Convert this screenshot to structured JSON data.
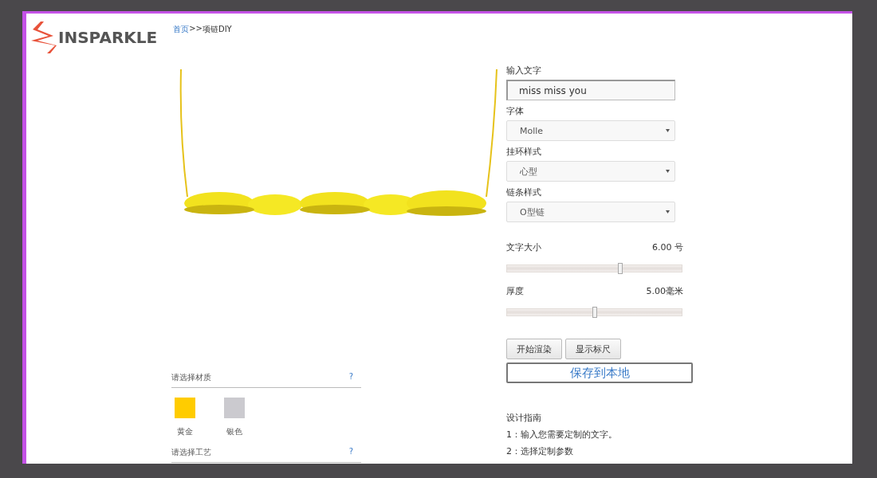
{
  "header": {
    "logo_text": "INSPARKLE",
    "breadcrumb": {
      "home": "首页",
      "separator": ">>",
      "current": "项链DIY"
    }
  },
  "sections": [
    {
      "title": "请选择材质",
      "help": "?",
      "materials": [
        {
          "label": "黄金",
          "color": "#ffcc00"
        },
        {
          "label": "银色",
          "color": "#cbcacf"
        }
      ]
    },
    {
      "title": "请选择工艺",
      "help": "?"
    }
  ],
  "form": {
    "text_label": "输入文字",
    "text_value": "miss miss you",
    "selects": [
      {
        "label": "字体",
        "value": "Molle"
      },
      {
        "label": "挂环样式",
        "value": "心型"
      },
      {
        "label": "链条样式",
        "value": "O型链"
      }
    ],
    "sliders": [
      {
        "label": "文字大小",
        "reading": "6.00 号",
        "level": 0.65
      },
      {
        "label": "厚度",
        "reading": "5.00毫米",
        "level": 0.5
      }
    ],
    "buttons": [
      "开始渲染",
      "显示标尺"
    ],
    "save_button": "保存到本地"
  },
  "guide": {
    "title": "设计指南",
    "steps": [
      "1：输入您需要定制的文字。",
      "2：选择定制参数"
    ]
  }
}
